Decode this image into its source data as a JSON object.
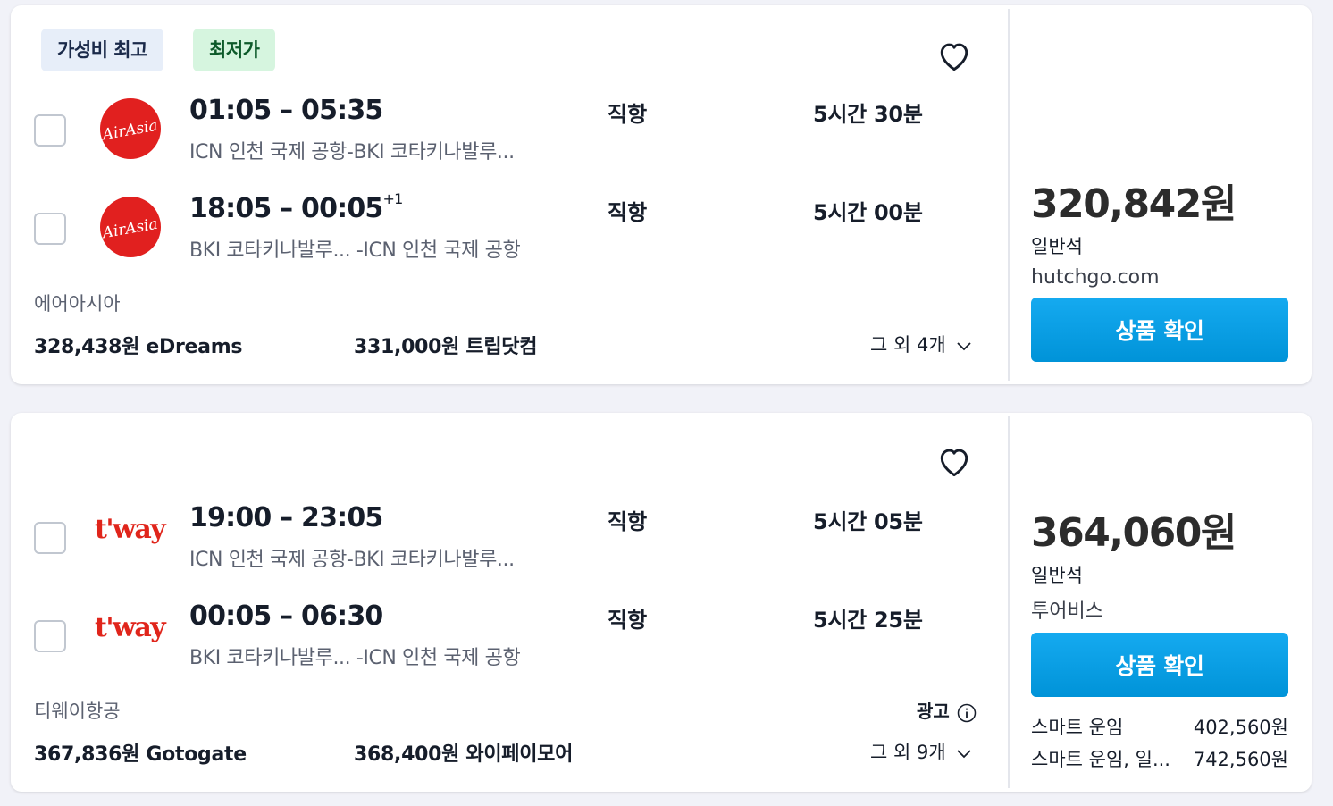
{
  "results": [
    {
      "badges": [
        "가성비 최고",
        "최저가"
      ],
      "legs": [
        {
          "logo": "airasia-logo",
          "logo_text": "AirAsia",
          "depart": "01:05",
          "arrive": "05:35",
          "day_offset": "",
          "route": "ICN 인천 국제 공항-BKI 코타키나발루...",
          "stops": "직항",
          "duration": "5시간 30분"
        },
        {
          "logo": "airasia-logo",
          "logo_text": "AirAsia",
          "depart": "18:05",
          "arrive": "00:05",
          "day_offset": "+1",
          "route": "BKI 코타키나발루... -ICN 인천 국제 공항",
          "stops": "직항",
          "duration": "5시간 00분"
        }
      ],
      "airline": "에어아시아",
      "alt_prices": [
        {
          "price": "328,438원",
          "provider": "eDreams"
        },
        {
          "price": "331,000원",
          "provider": "트립닷컴"
        }
      ],
      "more_label": "그 외 4개",
      "price": "320,842원",
      "cabin": "일반석",
      "provider": "hutchgo.com",
      "cta_label": "상품 확인"
    },
    {
      "badges": [],
      "legs": [
        {
          "logo": "tway-logo",
          "logo_text": "t'way",
          "depart": "19:00",
          "arrive": "23:05",
          "day_offset": "",
          "route": "ICN 인천 국제 공항-BKI 코타키나발루...",
          "stops": "직항",
          "duration": "5시간 05분"
        },
        {
          "logo": "tway-logo",
          "logo_text": "t'way",
          "depart": "00:05",
          "arrive": "06:30",
          "day_offset": "",
          "route": "BKI 코타키나발루... -ICN 인천 국제 공항",
          "stops": "직항",
          "duration": "5시간 25분"
        }
      ],
      "airline": "티웨이항공",
      "alt_prices": [
        {
          "price": "367,836원",
          "provider": "Gotogate"
        },
        {
          "price": "368,400원",
          "provider": "와이페이모어"
        }
      ],
      "ad_label": "광고",
      "more_label": "그 외 9개",
      "price": "364,060원",
      "cabin": "일반석",
      "provider": "투어비스",
      "cta_label": "상품 확인",
      "fare_options": [
        {
          "name": "스마트 운임",
          "price": "402,560원"
        },
        {
          "name": "스마트 운임, 일...",
          "price": "742,560원"
        }
      ]
    }
  ],
  "colors": {
    "airasia": "#e1201f",
    "tway": "#e0251b",
    "cta": "#0ea1e6",
    "best_badge_bg": "#e7eef9",
    "cheap_badge_bg": "#d6f5df"
  }
}
